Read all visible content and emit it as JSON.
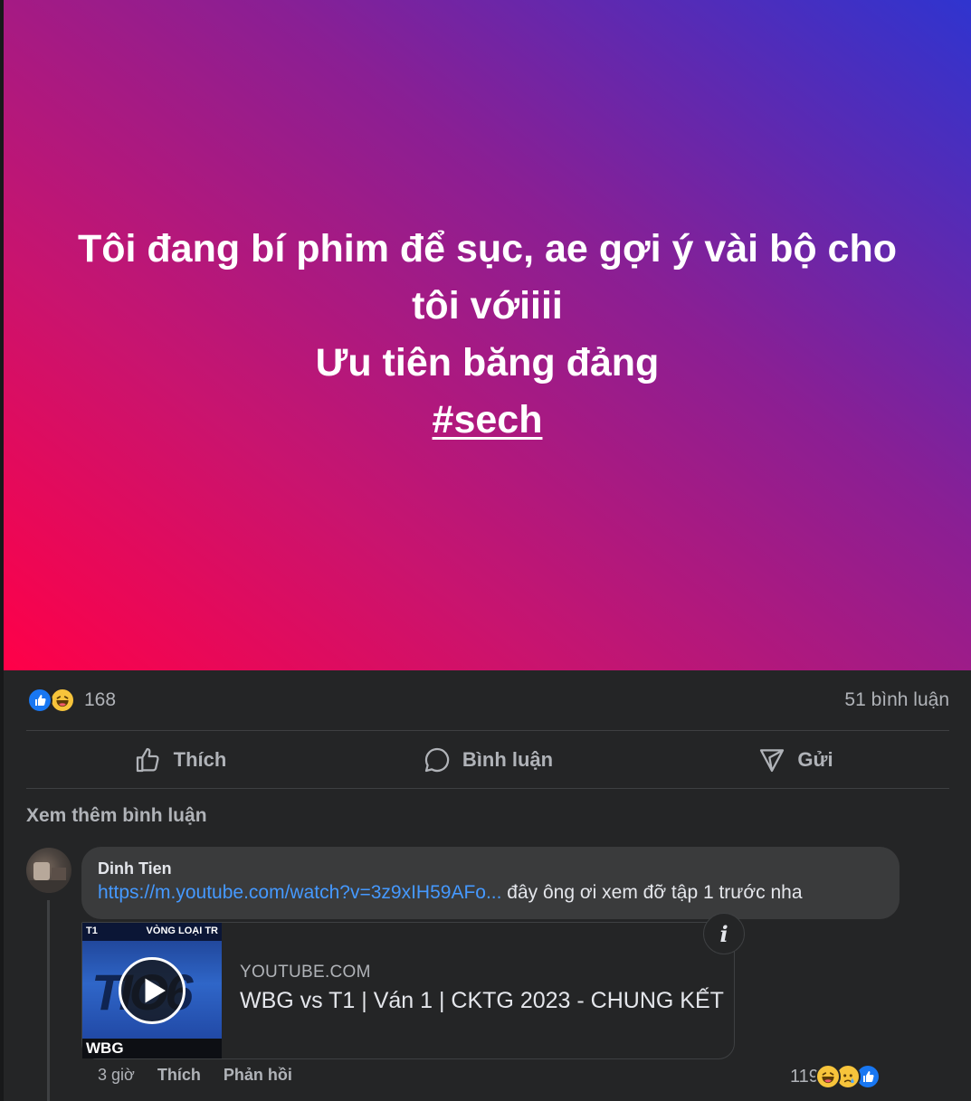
{
  "post": {
    "lines": [
      "Tôi đang bí phim để sục, ae gợi ý vài bộ cho",
      "tôi vớiiii",
      "Ưu tiên băng đảng"
    ],
    "hashtag": "#sech",
    "background_colors": [
      "#ff0048",
      "#c8146f",
      "#8a1f94",
      "#2f34cf"
    ]
  },
  "stats": {
    "reactions": [
      "like-icon",
      "haha-icon"
    ],
    "reaction_count": "168",
    "comment_count": "51 bình luận"
  },
  "actions": {
    "like_label": "Thích",
    "comment_label": "Bình luận",
    "send_label": "Gửi"
  },
  "comments_section": {
    "view_more_label": "Xem thêm bình luận"
  },
  "comment": {
    "author": "Dinh Tien",
    "link_text": "https://m.youtube.com/watch?v=3z9xIH59AFo...",
    "text": " đây ông ơi xem đỡ tập 1 trước nha",
    "preview": {
      "thumb_banner_left": "T1",
      "thumb_banner_right": "VÒNG LOẠI TR",
      "thumb_logo": "TIO6",
      "thumb_footer": "WBG",
      "domain": "YOUTUBE.COM",
      "title": "WBG vs T1 | Ván 1 | CKTG 2023 - CHUNG KẾT"
    },
    "time": "3 giờ",
    "like_label": "Thích",
    "reply_label": "Phản hồi",
    "reaction_count": "119",
    "reactions": [
      "haha-icon",
      "sad-icon",
      "like-icon"
    ]
  },
  "colors": {
    "link": "#4599ff",
    "like_blue": "#1877f2",
    "page_bg": "#242526",
    "bubble_bg": "#3a3b3c"
  }
}
